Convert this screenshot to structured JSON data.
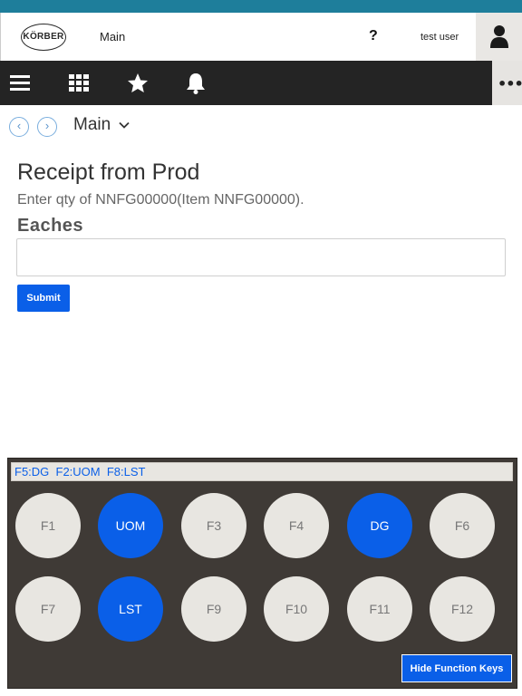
{
  "header": {
    "logo_text": "KÖRBER",
    "title": "Main",
    "help_label": "?",
    "user_name": "test user"
  },
  "toolbar": {
    "icons": [
      "menu-icon",
      "grid-icon",
      "star-icon",
      "bell-icon"
    ],
    "more_label": "•••"
  },
  "nav": {
    "back_label": "‹",
    "forward_label": "›",
    "breadcrumb": "Main"
  },
  "form": {
    "title": "Receipt from Prod",
    "prompt": "Enter qty of NNFG00000(Item NNFG00000).",
    "field_label": "Eaches",
    "field_value": "",
    "submit_label": "Submit"
  },
  "function_keys": {
    "hint_bar": "F5:DG  F2:UOM  F8:LST",
    "keys": [
      {
        "label": "F1",
        "active": false
      },
      {
        "label": "UOM",
        "active": true
      },
      {
        "label": "F3",
        "active": false
      },
      {
        "label": "F4",
        "active": false
      },
      {
        "label": "DG",
        "active": true
      },
      {
        "label": "F6",
        "active": false
      },
      {
        "label": "F7",
        "active": false
      },
      {
        "label": "LST",
        "active": true
      },
      {
        "label": "F9",
        "active": false
      },
      {
        "label": "F10",
        "active": false
      },
      {
        "label": "F11",
        "active": false
      },
      {
        "label": "F12",
        "active": false
      }
    ],
    "hide_label": "Hide Function Keys"
  },
  "colors": {
    "accent": "#0a5fe8",
    "toolbar_bg": "#242424",
    "panel_bg": "#3f3a36",
    "top_strip": "#1e7e9b"
  }
}
